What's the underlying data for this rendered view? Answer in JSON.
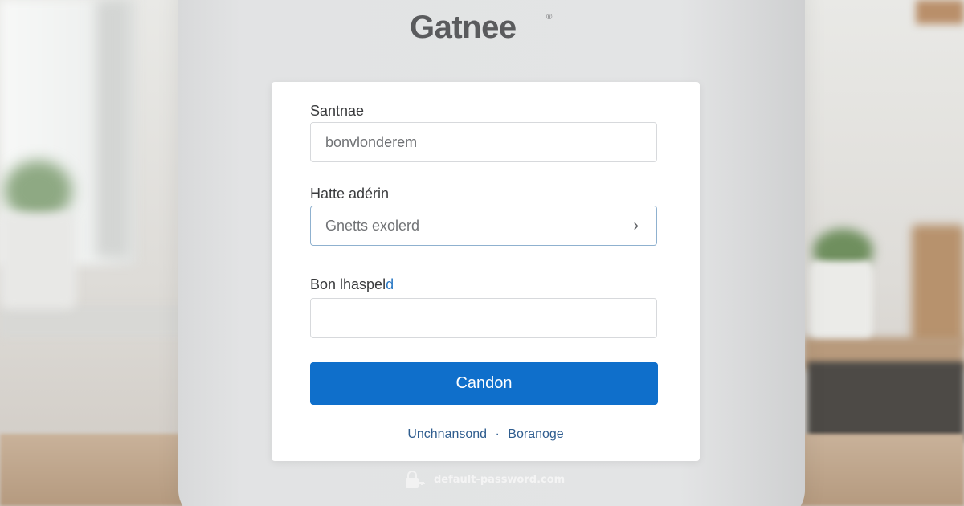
{
  "brand": {
    "name": "Gatnee",
    "mark": "®"
  },
  "login": {
    "field1": {
      "label": "Santnae",
      "value": "bonvlonderem"
    },
    "field2": {
      "label": "Hatte adérin",
      "value": "Gnetts exolerd",
      "icon": "chevron-right-icon"
    },
    "field3": {
      "label_main": "Bon lhaspel",
      "label_accent": "d",
      "value": ""
    },
    "submit_label": "Candon",
    "links": {
      "left": "Unchnansond",
      "separator": "·",
      "right": "Boranoge"
    }
  },
  "watermark": {
    "icon": "lock-icon",
    "text": "default-password.com"
  },
  "colors": {
    "primary": "#0f6fcb",
    "link": "#2f5d8f",
    "device": "#e2e3e4",
    "card": "#ffffff"
  }
}
